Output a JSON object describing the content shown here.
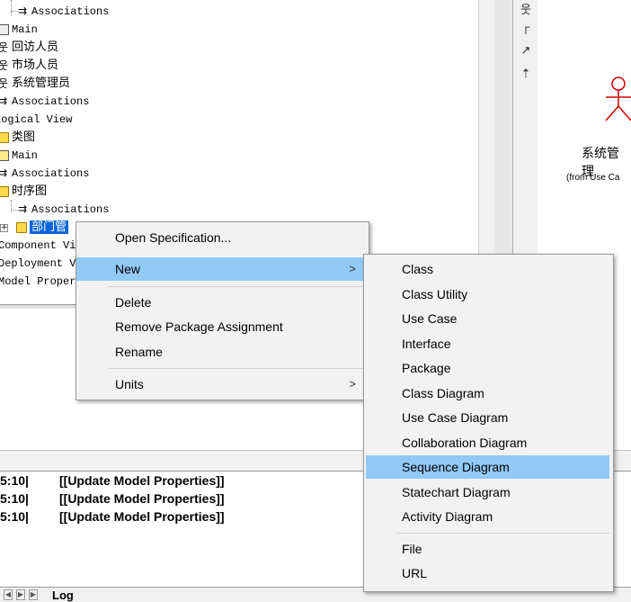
{
  "tree": {
    "items": [
      {
        "label": "Associations"
      },
      {
        "label": "Main"
      },
      {
        "label": "回访人员"
      },
      {
        "label": "市场人员"
      },
      {
        "label": "系统管理员"
      },
      {
        "label": "Associations"
      },
      {
        "label": "Logical View"
      },
      {
        "label": "类图"
      },
      {
        "label": "Main"
      },
      {
        "label": "Associations"
      },
      {
        "label": "时序图"
      },
      {
        "label": "Associations"
      },
      {
        "label": "部门管"
      },
      {
        "label": "Component Vi"
      },
      {
        "label": "Deployment V"
      },
      {
        "label": "Model Proper"
      }
    ]
  },
  "toolbox": {
    "icons": [
      "actor-tool-icon",
      "unidirectional-association-icon",
      "dependency-icon",
      "generalization-icon"
    ]
  },
  "diagram": {
    "actor_label": "系统管理",
    "from_label": "(from Use Ca"
  },
  "log": {
    "lines": [
      {
        "time": "5:10|",
        "message": "[[Update Model Properties]]"
      },
      {
        "time": "5:10|",
        "message": "[[Update Model Properties]]"
      },
      {
        "time": "5:10|",
        "message": "[[Update Model Properties]]"
      }
    ],
    "tab": "Log"
  },
  "context_menu": {
    "items": [
      {
        "label": "Open Specification..."
      },
      {
        "label": "New",
        "arrow": ">"
      },
      {
        "label": "Delete"
      },
      {
        "label": "Remove Package Assignment"
      },
      {
        "label": "Rename"
      },
      {
        "label": "Units",
        "arrow": ">"
      }
    ]
  },
  "submenu": {
    "items": [
      {
        "label": "Class"
      },
      {
        "label": "Class Utility"
      },
      {
        "label": "Use Case"
      },
      {
        "label": "Interface"
      },
      {
        "label": "Package"
      },
      {
        "label": "Class Diagram"
      },
      {
        "label": "Use Case Diagram"
      },
      {
        "label": "Collaboration Diagram"
      },
      {
        "label": "Sequence Diagram"
      },
      {
        "label": "Statechart Diagram"
      },
      {
        "label": "Activity Diagram"
      },
      {
        "label": "File"
      },
      {
        "label": "URL"
      }
    ]
  },
  "colors": {
    "menu_highlight": "#91c9f7",
    "tree_selection": "#0a64d8",
    "folder": "#ffd94a"
  }
}
